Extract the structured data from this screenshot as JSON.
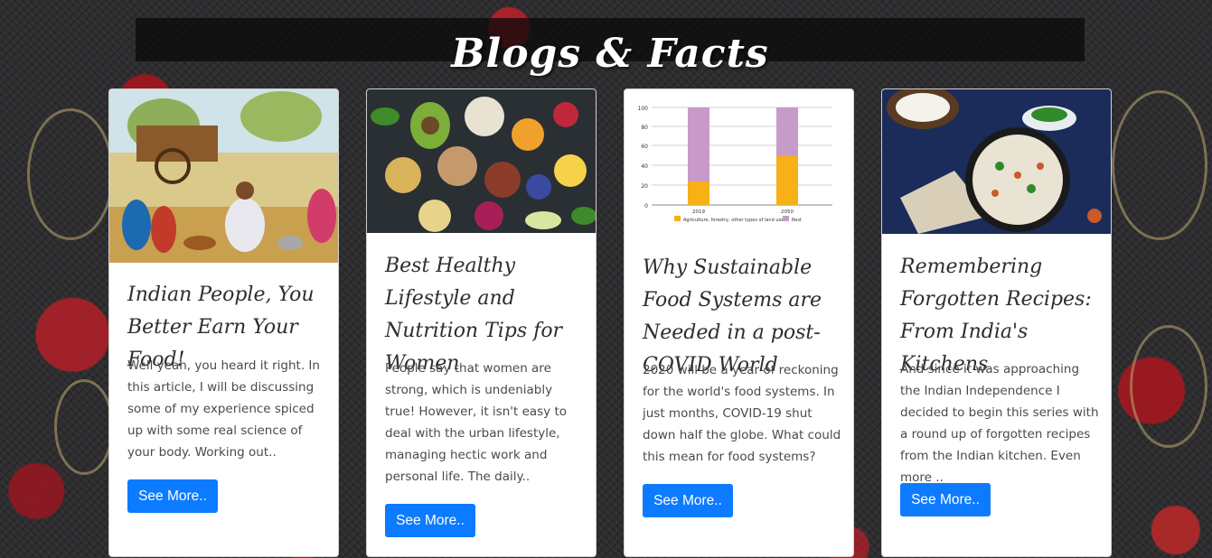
{
  "header": {
    "title": "Blogs & Facts"
  },
  "cards": [
    {
      "image": "indian-village-painting",
      "title": "Indian People, You Better Earn Your Food!",
      "excerpt": "Well yeah, you heard it right. In this article, I will be discussing some of my experience spiced up with some real science of your body. Working out..",
      "button": "See More.."
    },
    {
      "image": "healthy-food-spread",
      "title": "Best Healthy Lifestyle and Nutrition Tips for Women",
      "excerpt": "People say that women are strong, which is undeniably true! However, it isn't easy to deal with the urban lifestyle, managing hectic work and personal life. The daily..",
      "button": "See More.."
    },
    {
      "image": "land-use-bar-chart",
      "title": "Why Sustainable Food Systems are Needed in a post-COVID World",
      "excerpt": "2020 will be a year of reckoning for the world's food systems. In just months, COVID-19 shut down half the globe. What could this mean for food systems?",
      "button": "See More..",
      "chart": {
        "y_ticks": [
          "100",
          "80",
          "60",
          "40",
          "20",
          "0"
        ],
        "x_labels": [
          "2019",
          "2050"
        ],
        "legend": [
          "Agriculture, forestry, other types of land use",
          "Rest"
        ]
      }
    },
    {
      "image": "rice-dish-with-coconut",
      "title": "Remembering Forgotten Recipes: From India's Kitchens",
      "excerpt": "And since it was approaching the Indian Independence I decided to begin this series with a round up of forgotten recipes from the Indian kitchen. Even more ..",
      "button": "See More.."
    }
  ],
  "colors": {
    "button": "#0d7bff",
    "header_bg": "#0a0a0a",
    "chart_orange": "#f7b015",
    "chart_purple": "#c89ac9"
  }
}
